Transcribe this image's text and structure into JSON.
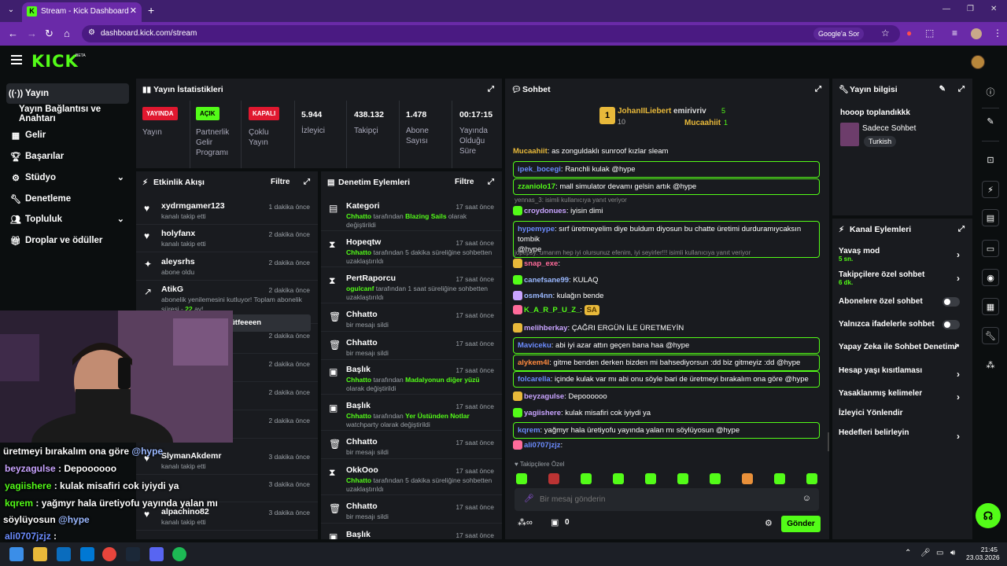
{
  "browser": {
    "tab_title": "Stream - Kick Dashboard",
    "url": "dashboard.kick.com/stream",
    "google_chip": "Google'a Sor"
  },
  "app": {
    "logo": "KICK",
    "logo_beta": "BETA"
  },
  "sidebar": {
    "items": [
      {
        "label": "Yayın",
        "icon": "broadcast-icon"
      },
      {
        "label": "Yayın Bağlantısı ve Anahtarı"
      },
      {
        "label": "Gelir",
        "icon": "revenue-icon"
      },
      {
        "label": "Başarılar",
        "icon": "trophy-icon"
      },
      {
        "label": "Stüdyo",
        "icon": "studio-icon"
      },
      {
        "label": "Denetleme",
        "icon": "wrench-icon"
      },
      {
        "label": "Topluluk",
        "icon": "community-icon"
      },
      {
        "label": "Droplar ve ödüller",
        "icon": "gift-icon"
      }
    ]
  },
  "stats": {
    "title": "Yayın İstatistikleri",
    "live_badge": "YAYINDA",
    "live_label": "Yayın",
    "partner_badge": "AÇIK",
    "partner_label": [
      "Partnerlik",
      "Gelir",
      "Programı"
    ],
    "multi_badge": "KAPALI",
    "multi_label": [
      "Çoklu",
      "Yayın"
    ],
    "viewers": "5.944",
    "viewers_label": "İzleyici",
    "followers": "438.132",
    "followers_label": "Takipçi",
    "subs": "1.478",
    "subs_label": [
      "Abone",
      "Sayısı"
    ],
    "uptime": "00:17:15",
    "uptime_label": [
      "Yayında",
      "Olduğu",
      "Süre"
    ]
  },
  "activity": {
    "title": "Etkinlik Akışı",
    "filter": "Filtre",
    "rows": [
      {
        "name": "xydrmgamer123",
        "sub": "kanalı takip etti",
        "time": "1 dakika önce"
      },
      {
        "name": "holyfanx",
        "sub": "kanalı takip etti",
        "time": "2 dakika önce"
      },
      {
        "name": "aleysrhs",
        "sub": "abone oldu",
        "time": "2 dakika önce"
      },
      {
        "name": "AtikG",
        "sub": "abonelik yenilemesini kutluyor! Toplam abonelik",
        "sub2": "süresi - ",
        "months": "22",
        "months_suffix": " ay!",
        "time": "2 dakika önce"
      },
      {
        "name": "",
        "sub": "",
        "time": "2 dakika önce"
      },
      {
        "name": "",
        "sub": "",
        "time": "2 dakika önce"
      },
      {
        "name": "",
        "sub": "",
        "time": "2 dakika önce"
      },
      {
        "name": "",
        "sub": "",
        "time": "2 dakika önce"
      },
      {
        "name": "SlymanAkdemr",
        "sub": "kanalı takip etti",
        "time": "3 dakika önce"
      },
      {
        "name": "",
        "sub": "",
        "time": "3 dakika önce"
      },
      {
        "name": "alpachino82",
        "sub": "kanalı takip etti",
        "time": "3 dakika önce"
      }
    ],
    "tooltip": "ütfeeeen"
  },
  "moderation": {
    "title": "Denetim Eylemleri",
    "filter": "Filtre",
    "rows": [
      {
        "icon": "category-icon",
        "name": "Kategori",
        "sub_pre": "Chhatto",
        "sub_mid": " tarafından ",
        "sub_green": "Blazing Sails",
        "sub_post": " olarak",
        "sub2": "değiştirildi",
        "time": "17 saat önce"
      },
      {
        "icon": "hourglass-icon",
        "name": "Hopeqtw",
        "sub_pre": "Chhatto",
        "sub_mid": " tarafından 5 dakika süreliğine sohbetten",
        "sub_green": "",
        "sub_post": "",
        "sub2": "uzaklaştırıldı",
        "time": "17 saat önce"
      },
      {
        "icon": "hourglass-icon",
        "name": "PertRaporcu",
        "sub_pre": "ogulcanf",
        "sub_mid": " tarafından 1 saat süreliğine sohbetten",
        "sub_green": "",
        "sub_post": "",
        "sub2": "uzaklaştırıldı",
        "time": "17 saat önce"
      },
      {
        "icon": "trash-icon",
        "name": "Chhatto",
        "sub_pre": "",
        "sub_mid": "bir mesajı sildi",
        "sub_green": "",
        "sub_post": "",
        "sub2": "",
        "time": "17 saat önce"
      },
      {
        "icon": "trash-icon",
        "name": "Chhatto",
        "sub_pre": "",
        "sub_mid": "bir mesajı sildi",
        "sub_green": "",
        "sub_post": "",
        "sub2": "",
        "time": "17 saat önce"
      },
      {
        "icon": "title-icon",
        "name": "Başlık",
        "sub_pre": "Chhatto",
        "sub_mid": " tarafından ",
        "sub_green": "Madalyonun diğer yüzü",
        "sub_post": "",
        "sub2": "olarak değiştirildi",
        "time": "17 saat önce"
      },
      {
        "icon": "title-icon",
        "name": "Başlık",
        "sub_pre": "Chhatto",
        "sub_mid": " tarafından ",
        "sub_green": "Yer Üstünden Notlar",
        "sub_post": "",
        "sub2": "watchparty olarak değiştirildi",
        "time": "17 saat önce"
      },
      {
        "icon": "trash-icon",
        "name": "Chhatto",
        "sub_pre": "",
        "sub_mid": "bir mesajı sildi",
        "sub_green": "",
        "sub_post": "",
        "sub2": "",
        "time": "17 saat önce"
      },
      {
        "icon": "hourglass-icon",
        "name": "OkkOoo",
        "sub_pre": "Chhatto",
        "sub_mid": " tarafından 5 dakika süreliğine sohbetten",
        "sub_green": "",
        "sub_post": "",
        "sub2": "uzaklaştırıldı",
        "time": "17 saat önce"
      },
      {
        "icon": "trash-icon",
        "name": "Chhatto",
        "sub_pre": "",
        "sub_mid": "bir mesajı sildi",
        "sub_green": "",
        "sub_post": "",
        "sub2": "",
        "time": "17 saat önce"
      },
      {
        "icon": "title-icon",
        "name": "Başlık",
        "sub_pre": "",
        "sub_mid": "",
        "sub_green": "",
        "sub_post": "",
        "sub2": "",
        "time": "17 saat önce"
      }
    ]
  },
  "chat": {
    "title": "Sohbet",
    "leaders": [
      {
        "name": "JohanIILiebert",
        "count": "10",
        "rank": "1"
      },
      {
        "name": "emirivriv",
        "count": "5"
      },
      {
        "name": "Mucaahiit",
        "count": "1"
      }
    ],
    "messages": [
      {
        "user": "Mucaahiit",
        "text": ": as zonguldaklı sunroof kızlar sleam",
        "hl": false
      },
      {
        "user": "ipek_bocegi",
        "text": ": Ranchli kulak @hype",
        "hl": true
      },
      {
        "user": "zzaniolo17",
        "text": ": mall simulator devamı gelsin artık ",
        "tail": "@hype",
        "hl": true
      },
      {
        "reply": "yennas_3:   isimli kullanıcıya yanıt veriyor"
      },
      {
        "user": "croydonues",
        "text": ":           iyisin dimi",
        "hl": false
      },
      {
        "user": "hypemype",
        "text": ": sırf üretmeyelim diye buldum diyosun bu chatte üretimi durduramıycaksın tombik",
        "text2": "@hype",
        "hl": true
      },
      {
        "reply": "jopepsy: umarım hep iyi olursunuz efenim, iyi seyirler!!! isimli kullanıcıya yanıt veriyor"
      },
      {
        "user": "snap_exe",
        "text": ": ",
        "hl": false
      },
      {
        "user": "canefsane99",
        "text": ": KULAQ",
        "hl": false
      },
      {
        "user": "osm4nn",
        "text": ": kulağın bende",
        "hl": false
      },
      {
        "user": "K_A_R_P_U_Z_",
        "text": ":  ",
        "emote": "SA",
        "hl": false
      },
      {
        "user": "melihberkay",
        "text": ": ÇAĞRI ERGÜN İLE ÜRETMEYİN",
        "hl": false
      },
      {
        "user": "Maviceku",
        "text": ": abi iyi azar attın geçen bana haa @hype",
        "hl": true
      },
      {
        "user": "alykem4l",
        "text": ": gitme benden derken bizden mi bahsediyorsun :dd biz gitmeyiz :dd @hype",
        "hl": true
      },
      {
        "user": "folcarella",
        "text": ": içinde kulak var mı abi onu söyle bari de üretmeyi bırakalım ona göre @hype",
        "hl": true
      },
      {
        "user": "beyzagulse",
        "text": ": Depoooooo",
        "hl": false
      },
      {
        "user": "yagiishere",
        "text": ": kulak misafiri cok iyiydi ya",
        "hl": false
      },
      {
        "user": "kqrem",
        "text": ": yağmyr hala üretiyofu yayında yalan mı söylüyosun @hype",
        "hl": true
      },
      {
        "user": "ali0707jzjz",
        "text": ":",
        "hl": false
      }
    ],
    "followers_only": "Takipçilere Özel",
    "placeholder": "Bir mesaj gönderin",
    "points": "0",
    "send": "Gönder"
  },
  "info": {
    "title": "Yayın bilgisi",
    "stream_title": "hooop toplandıkkk",
    "category": "Sadece Sohbet",
    "language": "Turkish"
  },
  "channel_actions": {
    "title": "Kanal Eylemleri",
    "items": [
      {
        "label": "Yavaş mod",
        "sub": "5 sn.",
        "kind": "chevron"
      },
      {
        "label": "Takipçilere özel sohbet",
        "sub": "6 dk.",
        "kind": "chevron"
      },
      {
        "label": "Abonelere özel sohbet",
        "kind": "toggle"
      },
      {
        "label": "Yalnızca ifadelerle sohbet",
        "kind": "toggle"
      },
      {
        "label": "Yapay Zeka ile Sohbet Denetimi",
        "kind": "external"
      },
      {
        "label": "Hesap yaşı kısıtlaması",
        "kind": "chevron"
      },
      {
        "label": "Yasaklanmış kelimeler",
        "kind": "chevron"
      },
      {
        "label": "İzleyici Yönlendir",
        "kind": "none"
      },
      {
        "label": "Hedefleri belirleyin",
        "kind": "chevron"
      }
    ]
  },
  "overlay": {
    "lines": [
      {
        "text": "üretmeyi bırakalım ona göre ",
        "tag": "@hype"
      },
      {
        "user": "beyzagulse",
        "text": " : Depoooooo"
      },
      {
        "user": "yagiishere",
        "text": " : kulak misafiri cok iyiydi ya"
      },
      {
        "user": "kqrem",
        "text": " : yağmyr hala üretiyofu yayında yalan mı"
      },
      {
        "text": "söylüyosun ",
        "tag": "@hype"
      },
      {
        "user": "ali0707jzjz",
        "text": " :"
      }
    ]
  },
  "taskbar": {
    "time": "21:45",
    "date": "23.03.2026"
  },
  "colors": {
    "kick_green": "#53fc18",
    "browser_purple": "#6a2aa8",
    "panel": "#191b1f"
  }
}
